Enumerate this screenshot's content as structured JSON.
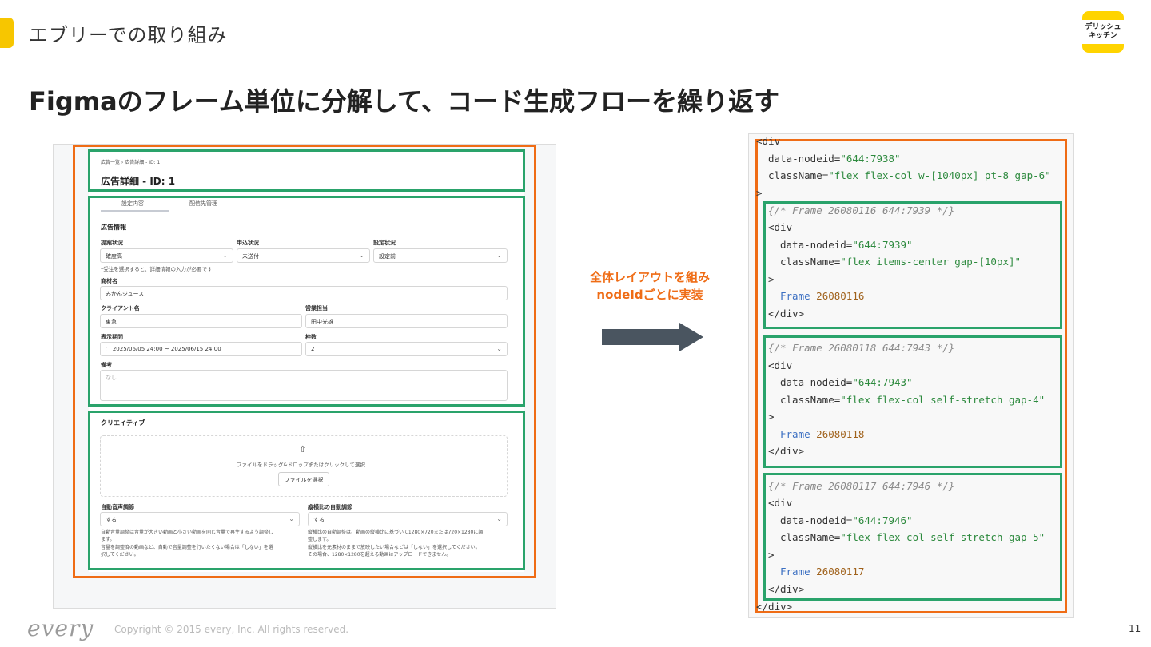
{
  "header": {
    "section_label": "エブリーでの取り組み",
    "logo_line1": "デリッシュ",
    "logo_line2": "キッチン",
    "title": "Figmaのフレーム単位に分解して、コード生成フローを繰り返す"
  },
  "mockup": {
    "breadcrumb": "広告一覧  ›  広告詳細 - ID: 1",
    "page_title": "広告詳細 - ID: 1",
    "tabs": [
      "設定内容",
      "配信先管理"
    ],
    "section_ad_info": "広告情報",
    "labels": {
      "proposal_status": "提案状況",
      "application_status": "申込状況",
      "setting_status": "設定状況",
      "product_name": "商材名",
      "client_name": "クライアント名",
      "sales_rep": "営業担当",
      "display_period": "表示期間",
      "slots": "枠数",
      "notes": "備考"
    },
    "values": {
      "proposal_status": "確度高",
      "application_status": "未送付",
      "setting_status": "設定前",
      "product_name": "みかんジュース",
      "client_name": "東急",
      "sales_rep": "田中光雄",
      "display_period": "2025/06/05 24:00 ~ 2025/06/15 24:00",
      "slots": "2",
      "notes_placeholder": "なし"
    },
    "hint": "*受注を選択すると、詳細情報の入力が必要です",
    "creative": {
      "title": "クリエイティブ",
      "drop_text": "ファイルをドラッグ&ドロップまたはクリックして選択",
      "select_button": "ファイルを選択",
      "auto_volume_label": "自動音声調節",
      "auto_volume_value": "する",
      "auto_volume_desc1": "自動音量調整は音量が大きい動画と小さい動画を同じ音量で再生するよう調整し",
      "auto_volume_desc2": "ます。",
      "auto_volume_desc3": "音量を調整済の動画など、自動で音量調整を行いたくない場合は「しない」を選",
      "auto_volume_desc4": "択してください。",
      "aspect_label": "縦横比の自動調節",
      "aspect_value": "する",
      "aspect_desc1": "縦横比の自動調整は、動画の縦横比に基づいて1280×720または720×1280に調",
      "aspect_desc2": "整します。",
      "aspect_desc3": "縦横比を元素材のままで放映したい場合などは「しない」を選択してください。",
      "aspect_desc4": "その場合、1280×1280を超える動画はアップロードできません。"
    }
  },
  "middle": {
    "line1": "全体レイアウトを組み",
    "line2": "nodeIdごとに実装"
  },
  "code": {
    "open_div": "<div",
    "root_nodeid_attr": "data-nodeid=",
    "root_nodeid_val": "\"644:7938\"",
    "root_class_attr": "className=",
    "root_class_val": "\"flex flex-col w-[1040px] pt-8 gap-6\"",
    "gt": ">",
    "close_div": "</div>",
    "blocks": [
      {
        "comment": "{/* Frame 26080116 644:7939 */}",
        "nodeid": "\"644:7939\"",
        "class": "\"flex items-center gap-[10px]\"",
        "frame_kw": "Frame",
        "frame_num": "26080116"
      },
      {
        "comment": "{/* Frame 26080118 644:7943 */}",
        "nodeid": "\"644:7943\"",
        "class": "\"flex flex-col self-stretch gap-4\"",
        "frame_kw": "Frame",
        "frame_num": "26080118"
      },
      {
        "comment": "{/* Frame 26080117 644:7946 */}",
        "nodeid": "\"644:7946\"",
        "class": "\"flex flex-col self-stretch gap-5\"",
        "frame_kw": "Frame",
        "frame_num": "26080117"
      }
    ]
  },
  "footer": {
    "brand": "every",
    "copyright": "Copyright © 2015 every, Inc. All rights reserved.",
    "page_number": "11"
  },
  "colors": {
    "accent": "#f7c600",
    "orange_frame": "#ef6c15",
    "green_frame": "#2aa36b",
    "arrow": "#4a5560"
  }
}
